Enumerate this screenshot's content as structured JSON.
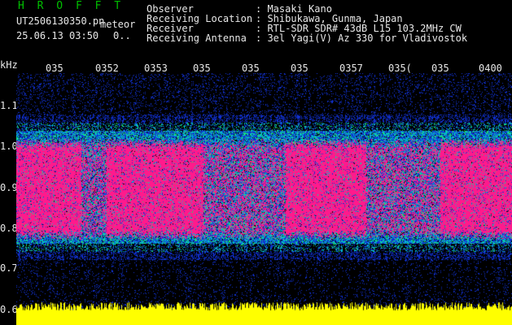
{
  "header": {
    "title": "H R O F F T",
    "file": "UT2506130350.pn",
    "meteor_label": "meteor",
    "date_time": "25.06.13 03:50",
    "count": "0.."
  },
  "info": {
    "rows": [
      {
        "label": "Observer",
        "value": ": Masaki Kano"
      },
      {
        "label": "Receiving Location",
        "value": ": Shibukawa, Gunma, Japan"
      },
      {
        "label": "Receiver",
        "value": ": RTL-SDR SDR# 43dB L15 103.2MHz CW"
      },
      {
        "label": "Receiving Antenna",
        "value": ": 3el Yagi(V) Az 330 for Vladivostok"
      }
    ]
  },
  "axes": {
    "y_unit": "kHz",
    "y_ticks": [
      "1.1",
      "1.0",
      "0.9",
      "0.8",
      "0.7",
      "0.6"
    ],
    "x_ticks": [
      "035",
      "0352",
      "0353",
      "035",
      "035",
      "035",
      "0357",
      "035(",
      "035",
      "0400"
    ]
  },
  "colors": {
    "background": "#000000",
    "text": "#e8e8e8",
    "title": "#00c000",
    "noise_blue": "#1030d0",
    "noise_cyan": "#00c0d0",
    "echo_magenta": "#ff1a8c",
    "level_yellow": "#ffff00"
  }
}
